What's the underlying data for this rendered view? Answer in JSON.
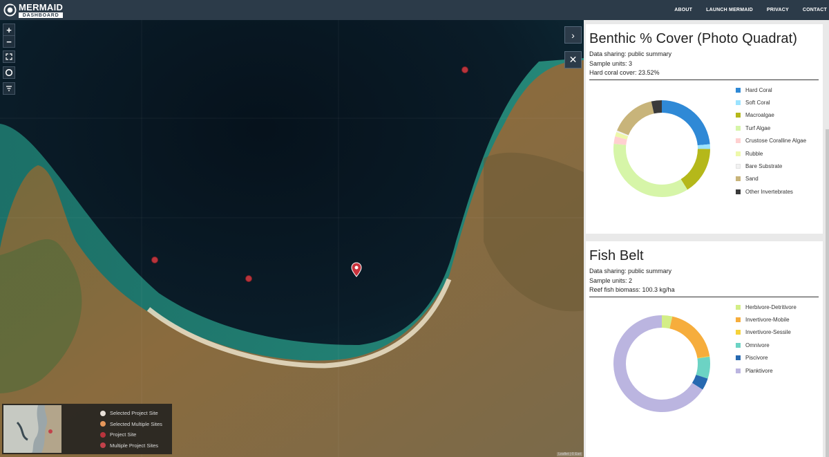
{
  "header": {
    "logo_title": "MERMAID",
    "logo_subtitle": "DASHBOARD",
    "nav": [
      "ABOUT",
      "LAUNCH MERMAID",
      "PRIVACY",
      "CONTACT"
    ]
  },
  "map": {
    "zoom_in": "+",
    "zoom_out": "−",
    "legend": [
      {
        "label": "Selected Project Site",
        "color": "#e8e0d8",
        "icon": "selected-site-icon"
      },
      {
        "label": "Selected Multiple Sites",
        "color": "#e6975a",
        "icon": "selected-multiple-sites-icon"
      },
      {
        "label": "Project Site",
        "color": "#b8343c",
        "icon": "project-site-icon"
      },
      {
        "label": "Multiple Project Sites",
        "color": "#c2414a",
        "icon": "multiple-project-sites-icon"
      }
    ],
    "attribution": "Leaflet | © Esri",
    "side_buttons": {
      "expand": "›",
      "close": "✕"
    }
  },
  "panels": [
    {
      "title": "Benthic % Cover (Photo Quadrat)",
      "sharing": "Data sharing: public summary",
      "sample_units": "Sample units: 3",
      "metric": "Hard coral cover: 23.52%",
      "chart_data": {
        "type": "pie",
        "categories": [
          "Hard Coral",
          "Soft Coral",
          "Macroalgae",
          "Turf Algae",
          "Crustose Coralline Algae",
          "Rubble",
          "Bare Substrate",
          "Sand",
          "Other Invertebrates"
        ],
        "values": [
          23.52,
          1.6,
          16.0,
          35.5,
          2.5,
          1.5,
          0.5,
          15.4,
          3.5
        ],
        "colors": [
          "#2f89d6",
          "#9be3ff",
          "#b5b81a",
          "#d6f5a8",
          "#ffd0d0",
          "#eef8aa",
          "#f2f2f2",
          "#c8b47a",
          "#3a3a3a"
        ]
      }
    },
    {
      "title": "Fish Belt",
      "sharing": "Data sharing: public summary",
      "sample_units": "Sample units: 2",
      "metric": "Reef fish biomass: 100.3 kg/ha",
      "chart_data": {
        "type": "pie",
        "categories": [
          "Herbivore-Detritivore",
          "Invertivore-Mobile",
          "Invertivore-Sessile",
          "Omnivore",
          "Piscivore",
          "Planktivore"
        ],
        "values": [
          3.5,
          19.0,
          0.2,
          7.3,
          4.0,
          66.0
        ],
        "colors": [
          "#d3ee86",
          "#f6ad3c",
          "#f5d23a",
          "#6cd3c4",
          "#2769b0",
          "#bbb5e0"
        ]
      }
    }
  ]
}
